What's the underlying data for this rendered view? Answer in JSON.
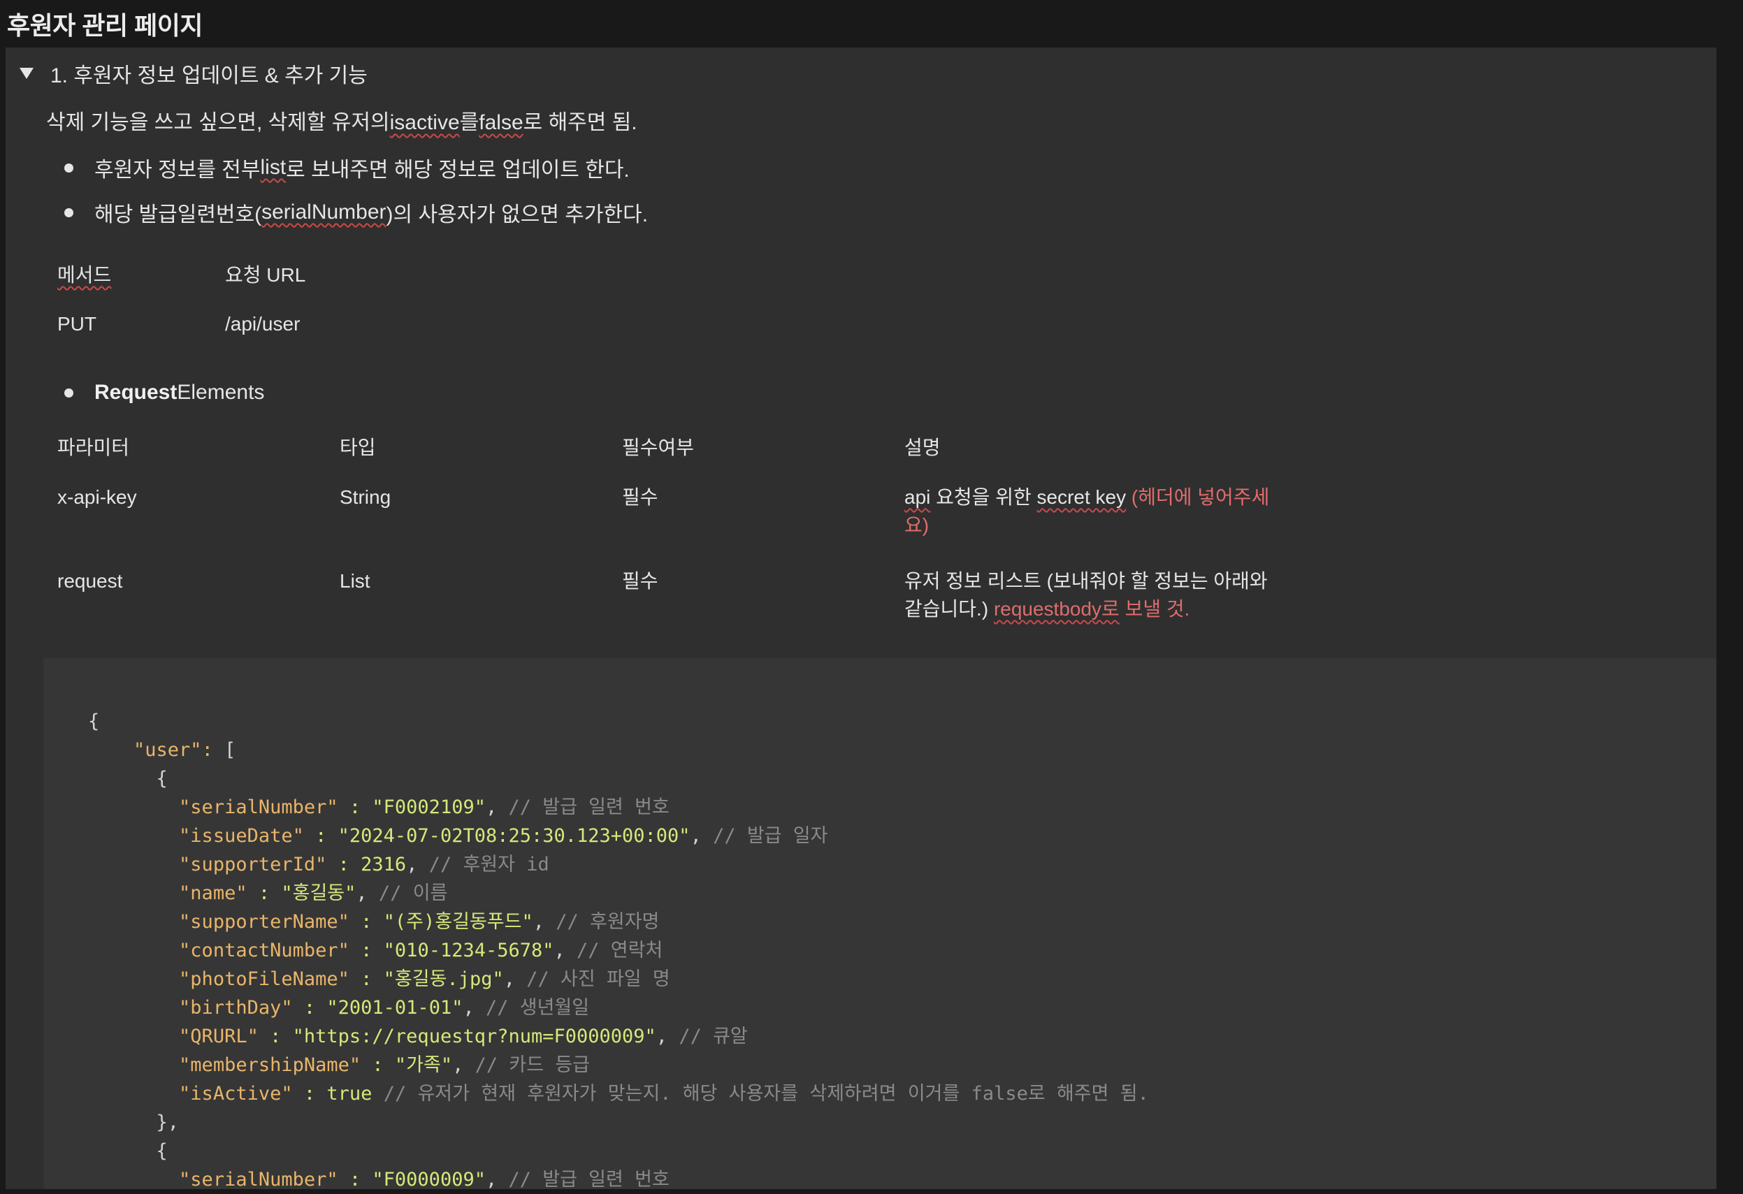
{
  "page": {
    "title": "후원자 관리 페이지"
  },
  "toggle": {
    "title": "1. 후원자 정보 업데이트 & 추가 기능"
  },
  "intro": {
    "part1": "삭제 기능을 쓰고 싶으면, 삭제할 유저의 ",
    "isactive": "isactive",
    "part2": "를 ",
    "false_word": "false",
    "part3": "로 해주면 됨."
  },
  "bullets": {
    "b1_part1": "후원자 정보를 전부 ",
    "b1_list": "list",
    "b1_part2": "로 보내주면 해당 정보로 업데이트 한다.",
    "b2_part1": "해당 발급일련번호(",
    "b2_serial": "serialNumber",
    "b2_part2": ")의 사용자가 없으면 추가한다."
  },
  "method_table": {
    "header_method": "메서드",
    "header_url": "요청 URL",
    "method": "PUT",
    "url": "/api/user"
  },
  "request_elements": {
    "bold": "Request",
    "rest": " Elements"
  },
  "param_table": {
    "headers": [
      "파라미터",
      "타입",
      "필수여부",
      "설명"
    ],
    "rows": [
      {
        "param": "x-api-key",
        "type": "String",
        "required": "필수",
        "desc_a": "api",
        "desc_b": " 요청을 위한 ",
        "desc_c": "secret key",
        "desc_red": " (헤더에 넣어주세요)"
      },
      {
        "param": "request",
        "type": "List",
        "required": "필수",
        "desc_plain": "유저 정보 리스트 (보내줘야 할 정보는 아래와 같습니다.) ",
        "desc_red_link": "requestbody로",
        "desc_red_tail": " 보낼 것."
      }
    ]
  },
  "code": {
    "lines": [
      {
        "indent": "",
        "key": "",
        "sep": "",
        "val": "",
        "tail": "{",
        "comment": ""
      },
      {
        "indent": "    ",
        "key": "\"user\"",
        "sep": ": ",
        "val": "",
        "tail": "[",
        "comment": ""
      },
      {
        "indent": "      ",
        "key": "",
        "sep": "",
        "val": "",
        "tail": "{",
        "comment": ""
      },
      {
        "indent": "        ",
        "key": "\"serialNumber\"",
        "sep": " : ",
        "val": "\"F0002109\"",
        "tail": ", ",
        "comment": "// 발급 일련 번호"
      },
      {
        "indent": "        ",
        "key": "\"issueDate\"",
        "sep": " : ",
        "val": "\"2024-07-02T08:25:30.123+00:00\"",
        "tail": ", ",
        "comment": "// 발급 일자"
      },
      {
        "indent": "        ",
        "key": "\"supporterId\"",
        "sep": " : ",
        "val": "2316",
        "tail": ", ",
        "comment": "// 후원자 id"
      },
      {
        "indent": "        ",
        "key": "\"name\"",
        "sep": " : ",
        "val": "\"홍길동\"",
        "tail": ", ",
        "comment": "// 이름"
      },
      {
        "indent": "        ",
        "key": "\"supporterName\"",
        "sep": " : ",
        "val": "\"(주)홍길동푸드\"",
        "tail": ", ",
        "comment": "// 후원자명"
      },
      {
        "indent": "        ",
        "key": "\"contactNumber\"",
        "sep": " : ",
        "val": "\"010-1234-5678\"",
        "tail": ", ",
        "comment": "// 연락처"
      },
      {
        "indent": "        ",
        "key": "\"photoFileName\"",
        "sep": " : ",
        "val": "\"홍길동.jpg\"",
        "tail": ", ",
        "comment": "// 사진 파일 명"
      },
      {
        "indent": "        ",
        "key": "\"birthDay\"",
        "sep": " : ",
        "val": "\"2001-01-01\"",
        "tail": ", ",
        "comment": "// 생년월일"
      },
      {
        "indent": "        ",
        "key": "\"QRURL\"",
        "sep": " : ",
        "val": "\"https://requestqr?num=F0000009\"",
        "tail": ", ",
        "comment": "// 큐알"
      },
      {
        "indent": "        ",
        "key": "\"membershipName\"",
        "sep": " : ",
        "val": "\"가족\"",
        "tail": ", ",
        "comment": "// 카드 등급"
      },
      {
        "indent": "        ",
        "key": "\"isActive\"",
        "sep": " : ",
        "val": "true",
        "tail": " ",
        "comment": "// 유저가 현재 후원자가 맞는지. 해당 사용자를 삭제하려면 이거를 false로 해주면 됨."
      },
      {
        "indent": "      ",
        "key": "",
        "sep": "",
        "val": "",
        "tail": "},",
        "comment": ""
      },
      {
        "indent": "      ",
        "key": "",
        "sep": "",
        "val": "",
        "tail": "{",
        "comment": ""
      },
      {
        "indent": "        ",
        "key": "\"serialNumber\"",
        "sep": " : ",
        "val": "\"F0000009\"",
        "tail": ", ",
        "comment": "// 발급 일련 번호"
      }
    ]
  },
  "colors": {
    "background": "#191919",
    "block": "#2f2f2f",
    "code_bg": "#363636",
    "code_key": "#e9b56a",
    "code_value": "#d4e97a",
    "code_comment": "#8a8a8a",
    "red_text": "#e06c6c"
  },
  "icons": {
    "toggle": "triangle-down-icon"
  }
}
